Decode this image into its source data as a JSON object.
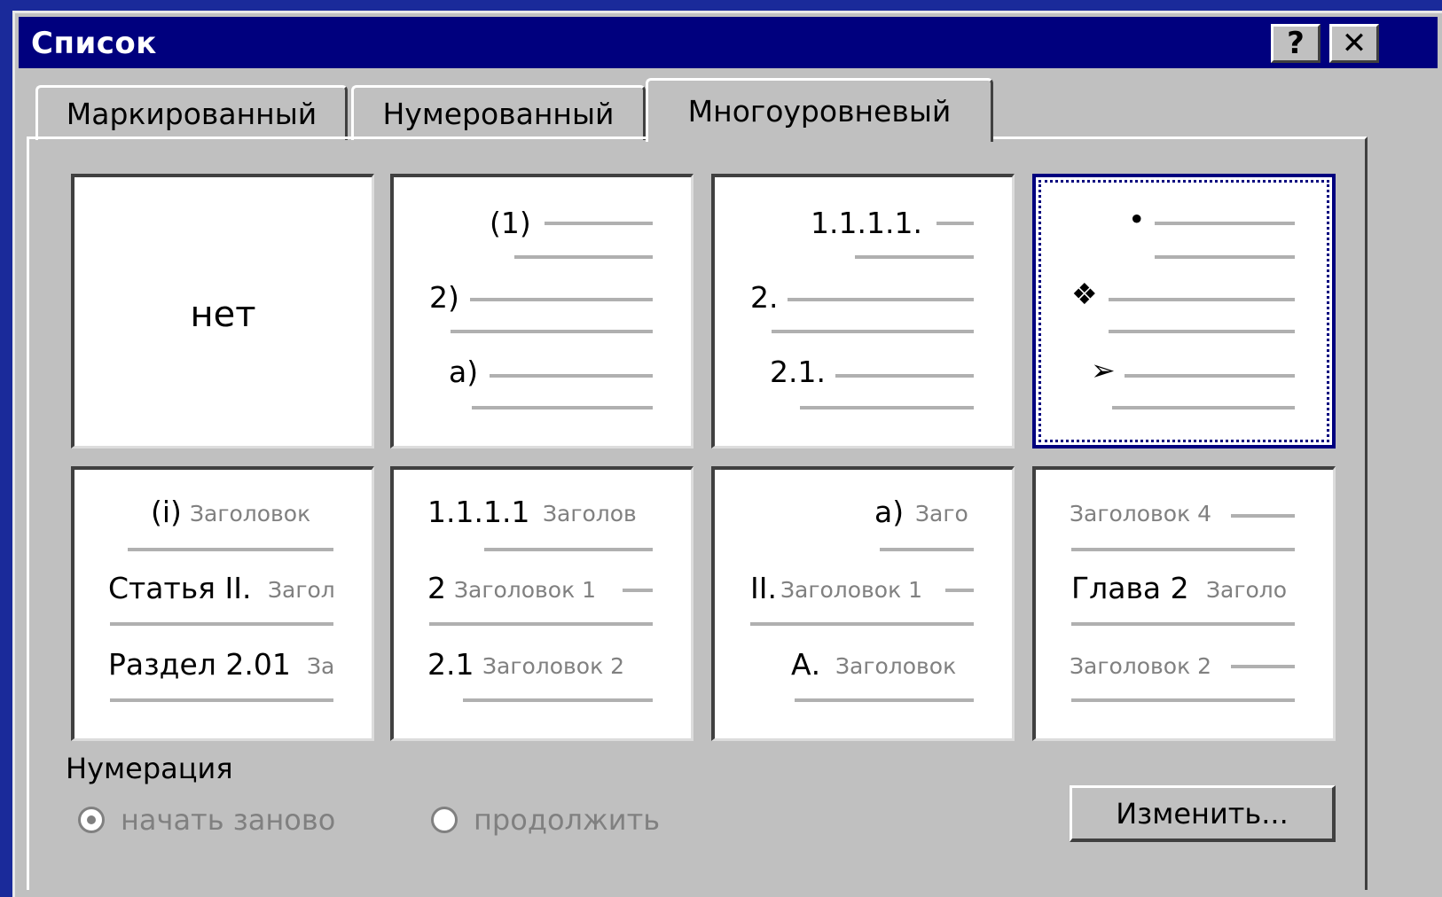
{
  "dialog": {
    "title": "Список",
    "help_label": "?",
    "close_label": "✕"
  },
  "tabs": [
    {
      "label": "Маркированный",
      "active": false
    },
    {
      "label": "Нумерованный",
      "active": false
    },
    {
      "label": "Многоуровневый",
      "active": true
    }
  ],
  "gallery": {
    "none_label": "нет",
    "cell2": {
      "l1": "(1)",
      "l2": "2)",
      "l3": "a)"
    },
    "cell3": {
      "l1": "1.1.1.1.",
      "l2": "2.",
      "l3": "2.1."
    },
    "cell4": {
      "l1": "•",
      "l2": "❖",
      "l3": "➢"
    },
    "cell5": {
      "r1_num": "(i)",
      "r1_text": "Заголовок",
      "r2_num": "Статья II.",
      "r2_text": "Загол",
      "r3_num": "Раздел 2.01",
      "r3_text": "За"
    },
    "cell6": {
      "r1_num": "1.1.1.1",
      "r1_text": "Заголов",
      "r2_num": "2",
      "r2_text": "Заголовок 1",
      "r3_num": "2.1",
      "r3_text": "Заголовок 2"
    },
    "cell7": {
      "r1_num": "а)",
      "r1_text": "Заго",
      "r2_num": "II.",
      "r2_text": "Заголовок 1",
      "r3_num": "А.",
      "r3_text": "Заголовок"
    },
    "cell8": {
      "r1_text": "Заголовок 4",
      "r2_num": "Глава 2",
      "r2_text": "Заголо",
      "r3_text": "Заголовок 2"
    }
  },
  "numbering": {
    "label": "Нумерация",
    "restart_label": "начать заново",
    "continue_label": "продолжить",
    "restart_selected": true
  },
  "modify_button": {
    "label": "Изменить..."
  }
}
